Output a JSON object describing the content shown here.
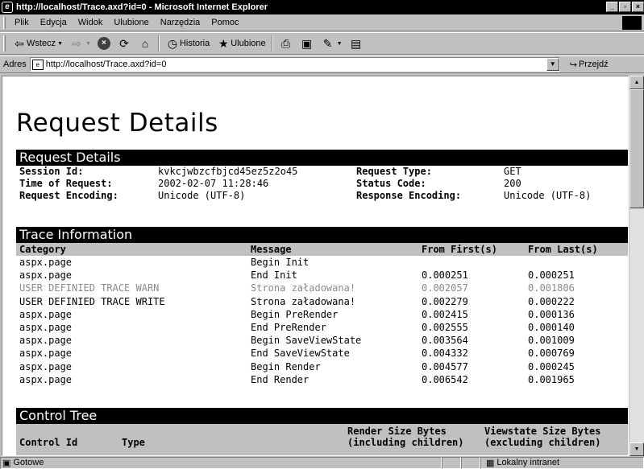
{
  "window": {
    "title": "http://localhost/Trace.axd?id=0 - Microsoft Internet Explorer",
    "logo_glyph": "e"
  },
  "menu": [
    "Plik",
    "Edycja",
    "Widok",
    "Ulubione",
    "Narzędzia",
    "Pomoc"
  ],
  "toolbar": {
    "back_label": "Wstecz",
    "history_label": "Historia",
    "favorites_label": "Ulubione"
  },
  "address": {
    "label": "Adres",
    "url": "http://localhost/Trace.axd?id=0",
    "go_label": "Przejdź"
  },
  "page": {
    "title": "Request Details",
    "request_section": {
      "title": "Request Details",
      "rows": [
        {
          "k1": "Session Id:",
          "v1": "kvkcjwbzcfbjcd45ez5z2o45",
          "k2": "Request Type:",
          "v2": "GET"
        },
        {
          "k1": "Time of Request:",
          "v1": "2002-02-07 11:28:46",
          "k2": "Status Code:",
          "v2": "200"
        },
        {
          "k1": "Request Encoding:",
          "v1": "Unicode (UTF-8)",
          "k2": "Response Encoding:",
          "v2": "Unicode (UTF-8)"
        }
      ]
    },
    "trace_section": {
      "title": "Trace Information",
      "columns": [
        "Category",
        "Message",
        "From First(s)",
        "From Last(s)"
      ],
      "rows": [
        {
          "category": "aspx.page",
          "message": "Begin Init",
          "first": "",
          "last": "",
          "warn": false
        },
        {
          "category": "aspx.page",
          "message": "End Init",
          "first": "0.000251",
          "last": "0.000251",
          "warn": false
        },
        {
          "category": "USER DEFINIED TRACE WARN",
          "message": "Strona załadowana!",
          "first": "0.002057",
          "last": "0.001806",
          "warn": true
        },
        {
          "category": "USER DEFINIED TRACE WRITE",
          "message": "Strona załadowana!",
          "first": "0.002279",
          "last": "0.000222",
          "warn": false
        },
        {
          "category": "aspx.page",
          "message": "Begin PreRender",
          "first": "0.002415",
          "last": "0.000136",
          "warn": false
        },
        {
          "category": "aspx.page",
          "message": "End PreRender",
          "first": "0.002555",
          "last": "0.000140",
          "warn": false
        },
        {
          "category": "aspx.page",
          "message": "Begin SaveViewState",
          "first": "0.003564",
          "last": "0.001009",
          "warn": false
        },
        {
          "category": "aspx.page",
          "message": "End SaveViewState",
          "first": "0.004332",
          "last": "0.000769",
          "warn": false
        },
        {
          "category": "aspx.page",
          "message": "Begin Render",
          "first": "0.004577",
          "last": "0.000245",
          "warn": false
        },
        {
          "category": "aspx.page",
          "message": "End Render",
          "first": "0.006542",
          "last": "0.001965",
          "warn": false
        }
      ]
    },
    "control_section": {
      "title": "Control Tree",
      "col_control_id": "Control Id",
      "col_type": "Type",
      "col_render_1": "Render Size Bytes",
      "col_render_2": "(including children)",
      "col_viewstate_1": "Viewstate Size Bytes",
      "col_viewstate_2": "(excluding children)"
    }
  },
  "status": {
    "text": "Gotowe",
    "zone": "Lokalny intranet"
  }
}
